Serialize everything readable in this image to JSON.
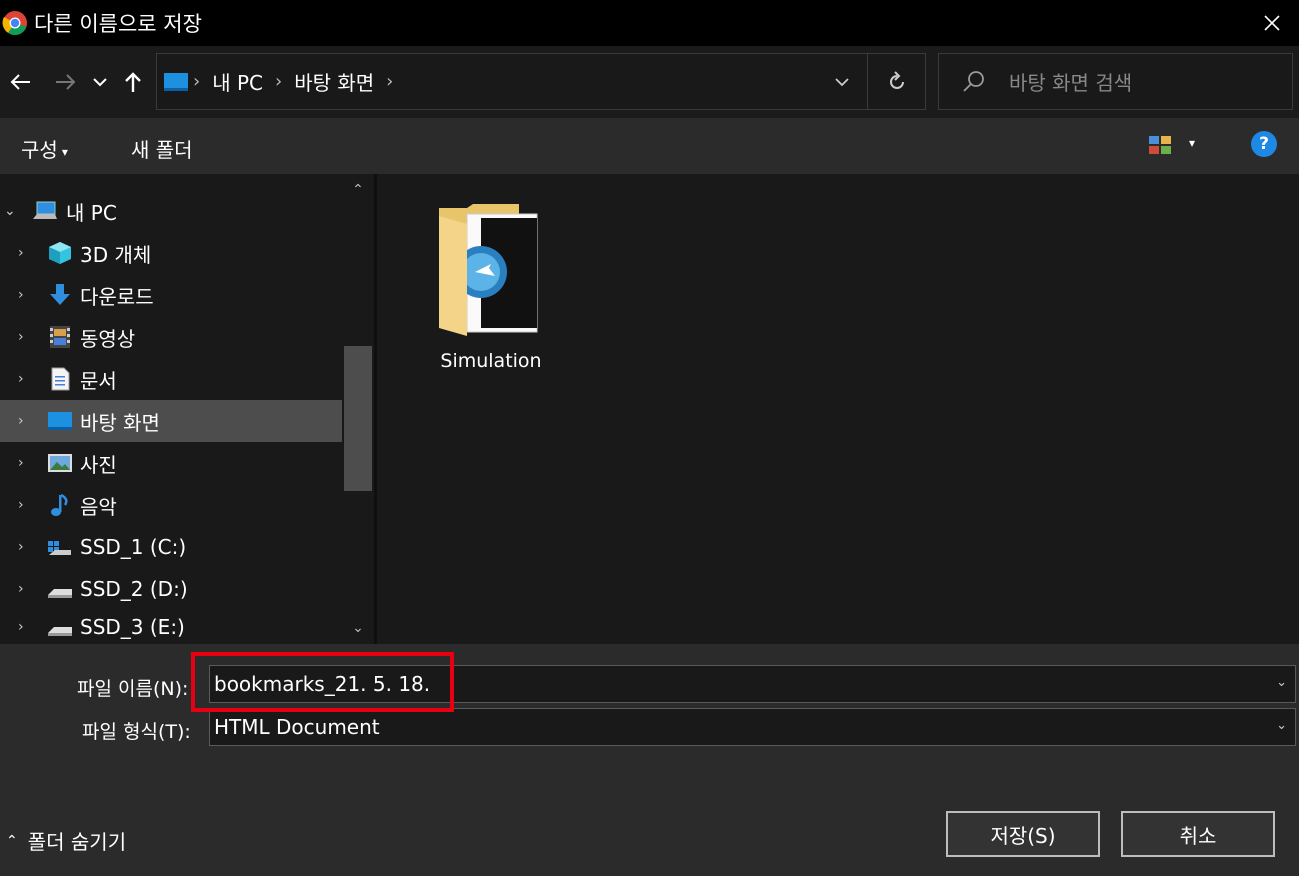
{
  "titlebar": {
    "title": "다른 이름으로 저장"
  },
  "address": {
    "crumbs": [
      "내 PC",
      "바탕 화면"
    ]
  },
  "search": {
    "placeholder": "바탕 화면 검색"
  },
  "toolbar": {
    "organize": "구성",
    "new_folder": "새 폴더"
  },
  "tree": [
    {
      "label": "내 PC",
      "expanded": true,
      "icon": "pc-icon"
    },
    {
      "label": "3D 개체",
      "icon": "3d-objects-icon"
    },
    {
      "label": "다운로드",
      "icon": "download-icon"
    },
    {
      "label": "동영상",
      "icon": "video-icon"
    },
    {
      "label": "문서",
      "icon": "document-icon"
    },
    {
      "label": "바탕 화면",
      "icon": "desktop-icon",
      "selected": true
    },
    {
      "label": "사진",
      "icon": "pictures-icon"
    },
    {
      "label": "음악",
      "icon": "music-icon"
    },
    {
      "label": "SSD_1 (C:)",
      "icon": "drive-icon"
    },
    {
      "label": "SSD_2 (D:)",
      "icon": "drive-icon"
    },
    {
      "label": "SSD_3 (E:)",
      "icon": "drive-icon"
    }
  ],
  "content": {
    "items": [
      {
        "name": "Simulation",
        "type": "folder"
      }
    ]
  },
  "form": {
    "filename_label": "파일 이름(N):",
    "filename_value": "bookmarks_21. 5. 18.",
    "filetype_label": "파일 형식(T):",
    "filetype_value": "HTML Document"
  },
  "footer": {
    "hide_folders": "폴더 숨기기",
    "save": "저장(S)",
    "cancel": "취소"
  },
  "colors": {
    "highlight": "#e60012",
    "selected": "#4d4d4d",
    "help": "#1e88e5"
  }
}
